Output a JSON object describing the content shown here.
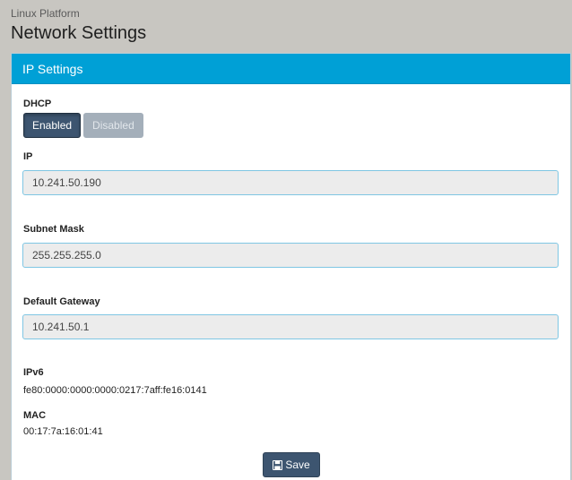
{
  "header": {
    "platform": "Linux Platform",
    "title": "Network Settings"
  },
  "panel": {
    "title": "IP Settings"
  },
  "dhcp": {
    "label": "DHCP",
    "enabled_label": "Enabled",
    "disabled_label": "Disabled",
    "selected": "Enabled"
  },
  "ip": {
    "label": "IP",
    "value": "10.241.50.190"
  },
  "subnet": {
    "label": "Subnet Mask",
    "value": "255.255.255.0"
  },
  "gateway": {
    "label": "Default Gateway",
    "value": "10.241.50.1"
  },
  "ipv6": {
    "label": "IPv6",
    "value": "fe80:0000:0000:0000:0217:7aff:fe16:0141"
  },
  "mac": {
    "label": "MAC",
    "value": "00:17:7a:16:01:41"
  },
  "save": {
    "label": "Save",
    "icon": "floppy-disk-icon"
  },
  "colors": {
    "page_bg": "#c8c6c1",
    "heading_bg": "#00a0d6",
    "button_primary": "#3d5570",
    "button_disabled": "#a4afba",
    "input_bg": "#ececec",
    "input_border": "#7fc6e3"
  }
}
